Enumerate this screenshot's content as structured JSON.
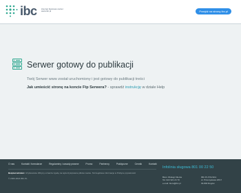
{
  "header": {
    "logo_text": "ibc",
    "logo_tagline": "internet business center www.ibc.pl",
    "cta_label": "Przejdź na stronę ibc.pl"
  },
  "main": {
    "title": "Serwer gotowy do publikacji",
    "description": "Twój Serwer www został uruchomiony i jest gotowy do publikacji treści",
    "help_question": "Jak umieścić stronę na koncie Ftp Serwera?",
    "help_prefix": " - sprawdź ",
    "help_link": "instrukcję",
    "help_suffix": " w dziale Help"
  },
  "footer": {
    "nav": [
      "O nas",
      "Kontakt i formularze",
      "Regulaminy i zasady prawne",
      "Promo",
      "Partnerzy",
      "Praktyczne",
      "Cennik",
      "Kontakt"
    ],
    "note_label": "Bezpieczeństwo:",
    "note_text": " Użytkowanie Witryny oznacza zgodę na wykorzystywanie plików cookie. Szczegółowe informacje w Polityce prywatności",
    "copyright": "© 2000-2024 IBC.PL",
    "infoline": "Infolinia sługowa 801 00 22 50",
    "address_left": [
      "Biuro Obsługi Klienta",
      "Tel. 022 321 24 70",
      "e-mail: biuro@ibc.pl"
    ],
    "address_right": [
      "IBC.PL POLSKA",
      "ul. Przemysłowa 18/17",
      "03-800 Rogów"
    ]
  },
  "colors": {
    "accent": "#2f8fe8",
    "logo_teal": "#2fa890",
    "footer_bg": "#324247",
    "page_bg": "#eef2f3"
  }
}
